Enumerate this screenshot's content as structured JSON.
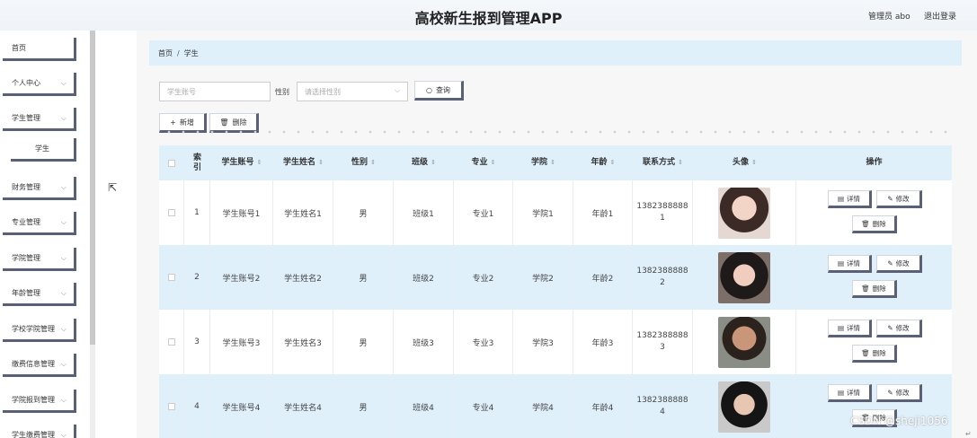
{
  "app": {
    "title": "高校新生报到管理APP",
    "user_label": "管理员 abo",
    "logout_label": "退出登录"
  },
  "sidebar": {
    "items": [
      {
        "label": "首页",
        "has_chevron": false
      },
      {
        "label": "个人中心",
        "has_chevron": true
      },
      {
        "label": "学生管理",
        "has_chevron": true
      },
      {
        "label": "学生",
        "sub": true
      },
      {
        "label": "财务管理",
        "has_chevron": true
      },
      {
        "label": "专业管理",
        "has_chevron": true
      },
      {
        "label": "学院管理",
        "has_chevron": true
      },
      {
        "label": "年龄管理",
        "has_chevron": true
      },
      {
        "label": "学校学院管理",
        "has_chevron": true
      },
      {
        "label": "缴费信息管理",
        "has_chevron": true
      },
      {
        "label": "学院报到管理",
        "has_chevron": true
      },
      {
        "label": "学生缴费管理",
        "has_chevron": true
      }
    ],
    "chevron": "chevron-down-icon"
  },
  "breadcrumb": {
    "home": "首页",
    "separator": "/",
    "current": "学生"
  },
  "search": {
    "account_placeholder": "学生账号",
    "gender_label": "性别",
    "gender_placeholder": "请选择性别",
    "query_label": "查询"
  },
  "toolbar": {
    "add_label": "新增",
    "delete_label": "删除"
  },
  "table": {
    "columns": [
      "索引",
      "学生账号",
      "学生姓名",
      "性别",
      "班级",
      "专业",
      "学院",
      "年龄",
      "联系方式",
      "头像",
      "操作"
    ],
    "sortable": [
      false,
      true,
      true,
      true,
      true,
      true,
      true,
      true,
      true,
      true,
      false
    ],
    "rows": [
      {
        "index": "1",
        "account": "学生账号1",
        "name": "学生姓名1",
        "gender": "男",
        "class": "班级1",
        "major": "专业1",
        "college": "学院1",
        "age": "年龄1",
        "phone_a": "1382388888",
        "phone_b": "1"
      },
      {
        "index": "2",
        "account": "学生账号2",
        "name": "学生姓名2",
        "gender": "男",
        "class": "班级2",
        "major": "专业2",
        "college": "学院2",
        "age": "年龄2",
        "phone_a": "1382388888",
        "phone_b": "2"
      },
      {
        "index": "3",
        "account": "学生账号3",
        "name": "学生姓名3",
        "gender": "男",
        "class": "班级3",
        "major": "专业3",
        "college": "学院3",
        "age": "年龄3",
        "phone_a": "1382388888",
        "phone_b": "3"
      },
      {
        "index": "4",
        "account": "学生账号4",
        "name": "学生姓名4",
        "gender": "男",
        "class": "班级4",
        "major": "专业4",
        "college": "学院4",
        "age": "年龄4",
        "phone_a": "1382388888",
        "phone_b": "4"
      }
    ],
    "actions": {
      "detail": "详情",
      "edit": "修改",
      "delete": "删除"
    }
  },
  "watermark": "CSDN @sheji1056",
  "colors": {
    "accent_light": "#dff0fb",
    "button_shadow": "#5a6177"
  }
}
